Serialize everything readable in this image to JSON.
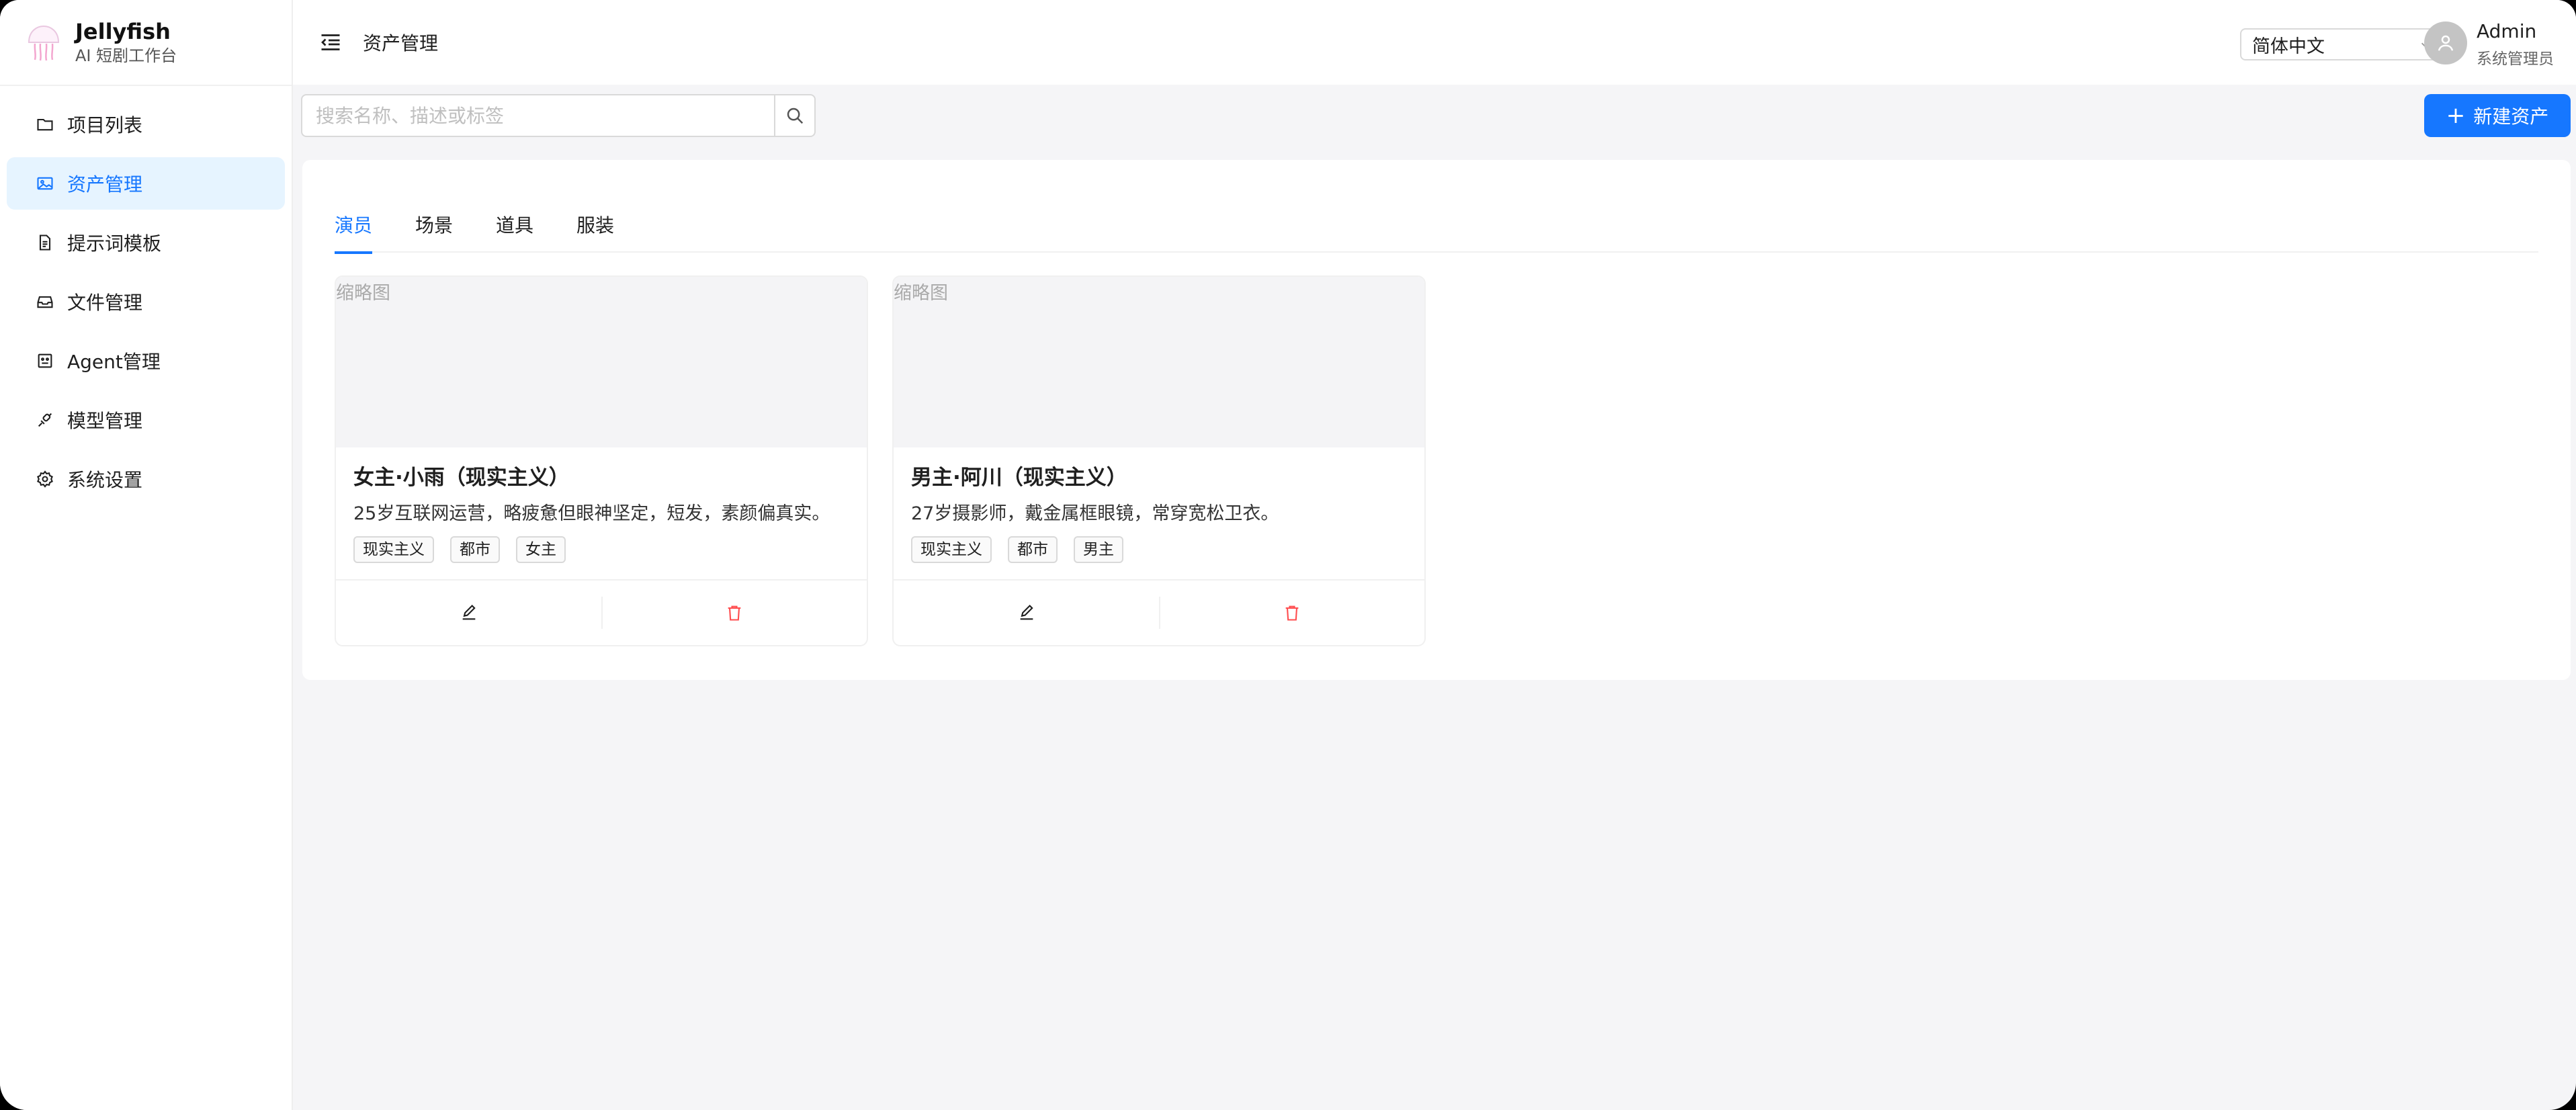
{
  "brand": {
    "title": "Jellyfish",
    "subtitle": "AI 短剧工作台",
    "logo_icon": "jellyfish-logo-icon"
  },
  "sidebar": {
    "items": [
      {
        "label": "项目列表",
        "icon": "folder-icon",
        "active": false
      },
      {
        "label": "资产管理",
        "icon": "image-icon",
        "active": true
      },
      {
        "label": "提示词模板",
        "icon": "file-text-icon",
        "active": false
      },
      {
        "label": "文件管理",
        "icon": "inbox-icon",
        "active": false
      },
      {
        "label": "Agent管理",
        "icon": "robot-icon",
        "active": false
      },
      {
        "label": "模型管理",
        "icon": "api-icon",
        "active": false
      },
      {
        "label": "系统设置",
        "icon": "gear-icon",
        "active": false
      }
    ]
  },
  "header": {
    "title": "资产管理",
    "language": "简体中文",
    "user": {
      "name": "Admin",
      "role": "系统管理员"
    }
  },
  "toolbar": {
    "search_placeholder": "搜索名称、描述或标签",
    "search_value": "",
    "new_button_label": "新建资产"
  },
  "tabs": [
    {
      "label": "演员",
      "active": true
    },
    {
      "label": "场景",
      "active": false
    },
    {
      "label": "道具",
      "active": false
    },
    {
      "label": "服装",
      "active": false
    }
  ],
  "cards": [
    {
      "thumbnail_label": "缩略图",
      "title": "女主·小雨（现实主义）",
      "description": "25岁互联网运营，略疲惫但眼神坚定，短发，素颜偏真实。",
      "tags": [
        "现实主义",
        "都市",
        "女主"
      ]
    },
    {
      "thumbnail_label": "缩略图",
      "title": "男主·阿川（现实主义）",
      "description": "27岁摄影师，戴金属框眼镜，常穿宽松卫衣。",
      "tags": [
        "现实主义",
        "都市",
        "男主"
      ]
    }
  ],
  "colors": {
    "accent": "#1677ff",
    "danger": "#ff4d4f",
    "active_bg": "#e6f4ff",
    "page_bg": "#f5f5f7"
  }
}
